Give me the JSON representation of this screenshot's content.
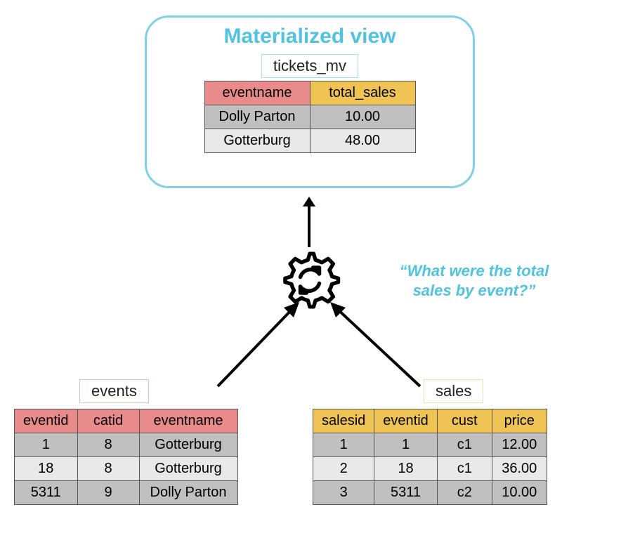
{
  "mv": {
    "title": "Materialized view",
    "label": "tickets_mv",
    "headers": {
      "c1": "eventname",
      "c2": "total_sales"
    },
    "rows": {
      "r0": {
        "c1": "Dolly Parton",
        "c2": "10.00"
      },
      "r1": {
        "c1": "Gotterburg",
        "c2": "48.00"
      }
    }
  },
  "question": "“What were the total sales by event?”",
  "events": {
    "label": "events",
    "headers": {
      "c1": "eventid",
      "c2": "catid",
      "c3": "eventname"
    },
    "rows": {
      "r0": {
        "c1": "1",
        "c2": "8",
        "c3": "Gotterburg"
      },
      "r1": {
        "c1": "18",
        "c2": "8",
        "c3": "Gotterburg"
      },
      "r2": {
        "c1": "5311",
        "c2": "9",
        "c3": "Dolly Parton"
      }
    }
  },
  "sales": {
    "label": "sales",
    "headers": {
      "c1": "salesid",
      "c2": "eventid",
      "c3": "cust",
      "c4": "price"
    },
    "rows": {
      "r0": {
        "c1": "1",
        "c2": "1",
        "c3": "c1",
        "c4": "12.00"
      },
      "r1": {
        "c1": "2",
        "c2": "18",
        "c3": "c1",
        "c4": "36.00"
      },
      "r2": {
        "c1": "3",
        "c2": "5311",
        "c3": "c2",
        "c4": "10.00"
      }
    }
  }
}
